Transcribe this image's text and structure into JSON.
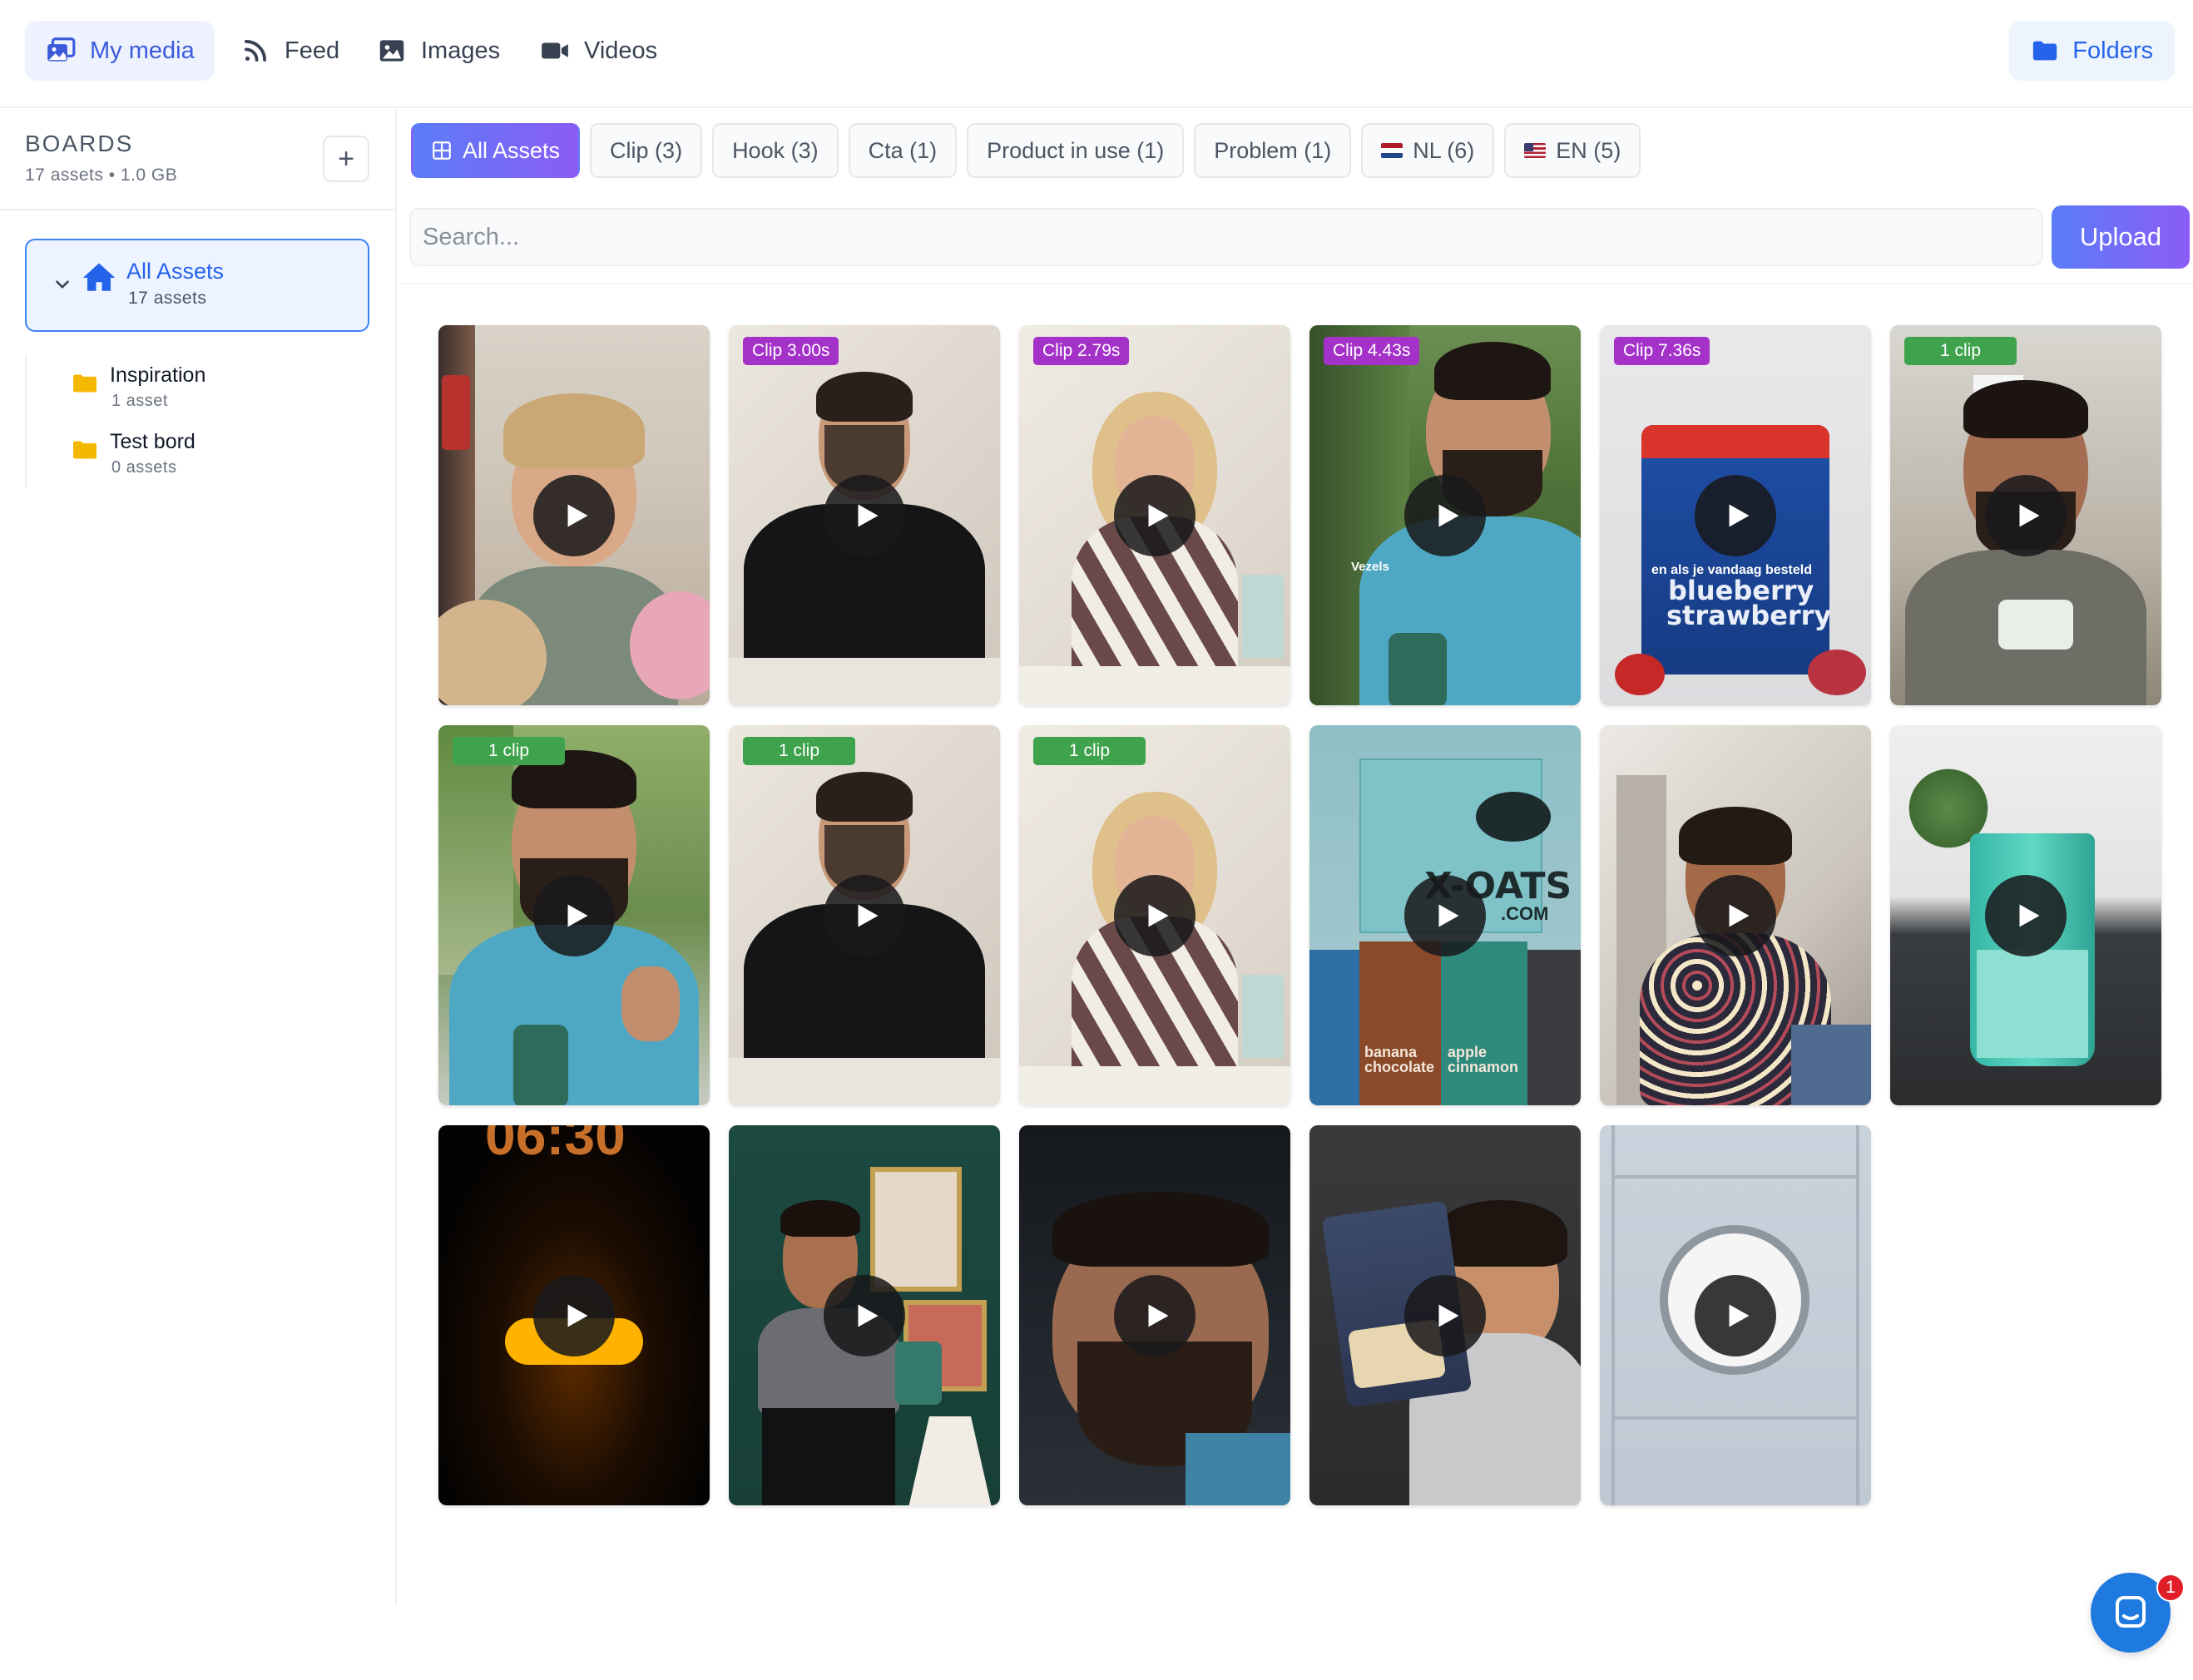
{
  "nav": {
    "tabs": [
      {
        "label": "My media",
        "icon": "photo-stack-icon",
        "active": true
      },
      {
        "label": "Feed",
        "icon": "rss-feed-icon",
        "active": false
      },
      {
        "label": "Images",
        "icon": "image-icon",
        "active": false
      },
      {
        "label": "Videos",
        "icon": "video-camera-icon",
        "active": false
      }
    ],
    "folders_label": "Folders"
  },
  "sidebar": {
    "title": "BOARDS",
    "meta": "17 assets • 1.0 GB",
    "add_label": "+",
    "all_assets": {
      "label": "All Assets",
      "count": "17 assets",
      "selected": true
    },
    "folders": [
      {
        "name": "Inspiration",
        "count": "1 asset"
      },
      {
        "name": "Test bord",
        "count": "0 assets"
      }
    ]
  },
  "filters": [
    {
      "label": "All Assets",
      "active": true,
      "icon": "grid-icon"
    },
    {
      "label": "Clip (3)"
    },
    {
      "label": "Hook (3)"
    },
    {
      "label": "Cta (1)"
    },
    {
      "label": "Product in use (1)"
    },
    {
      "label": "Problem (1)"
    },
    {
      "label": "NL (6)",
      "flag": "nl"
    },
    {
      "label": "EN (5)",
      "flag": "us"
    }
  ],
  "search": {
    "placeholder": "Search...",
    "value": ""
  },
  "upload_label": "Upload",
  "assets": [
    {
      "badge": "",
      "scene": "woman in fridge"
    },
    {
      "badge": "Clip 3.00s",
      "badge_type": "purple",
      "scene": "man black t-shirt"
    },
    {
      "badge": "Clip 2.79s",
      "badge_type": "purple",
      "scene": "woman patterned top"
    },
    {
      "badge": "Clip 4.43s",
      "badge_type": "purple",
      "scene": "man outdoors with shaker",
      "caption": "Vezels"
    },
    {
      "badge": "Clip 7.36s",
      "badge_type": "purple",
      "scene": "blueberry strawberry package",
      "caption": "en als je vandaag besteld",
      "package_text_1": "blueberry",
      "package_text_2": "strawberry"
    },
    {
      "badge": "1 clip",
      "badge_type": "green",
      "scene": "man in kitchen"
    },
    {
      "badge": "1 clip",
      "badge_type": "green",
      "scene": "man outdoors thumbs up"
    },
    {
      "badge": "1 clip",
      "badge_type": "green",
      "scene": "man black t-shirt"
    },
    {
      "badge": "1 clip",
      "badge_type": "green",
      "scene": "woman patterned top"
    },
    {
      "badge": "",
      "scene": "X-OATS products",
      "box_text": "X-OATS",
      "box_sub": ".COM",
      "bag_1": "banana chocolate",
      "bag_2": "apple cinnamon"
    },
    {
      "badge": "",
      "scene": "woman on phone"
    },
    {
      "badge": "",
      "scene": "green shaker cup"
    },
    {
      "badge": "",
      "scene": "alarm clock",
      "clock_text": "06:30"
    },
    {
      "badge": "",
      "scene": "woman with shaker green wall"
    },
    {
      "badge": "",
      "scene": "man close-up dark"
    },
    {
      "badge": "",
      "scene": "woman holding bag"
    },
    {
      "badge": "",
      "scene": "clock in fridge"
    }
  ],
  "chat": {
    "unread": "1"
  },
  "colors": {
    "accent": "#3b82f6",
    "gradient_start": "#5b7cfa",
    "gradient_end": "#8b5cf6",
    "clip_badge": "#a432c9",
    "count_badge": "#3fa34d"
  }
}
